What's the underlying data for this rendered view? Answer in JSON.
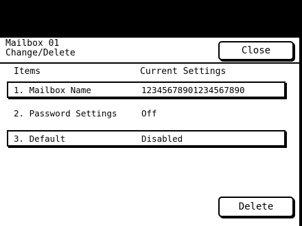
{
  "header": {
    "title_line1": "Mailbox 01",
    "title_line2": "Change/Delete",
    "close_label": "Close"
  },
  "columns": {
    "items": "Items",
    "current_settings": "Current Settings"
  },
  "rows": [
    {
      "item": "1. Mailbox Name",
      "value": "12345678901234567890",
      "selectable": true
    },
    {
      "item": "2. Password Settings",
      "value": "Off",
      "selectable": false
    },
    {
      "item": "3. Default",
      "value": "Disabled",
      "selectable": true
    }
  ],
  "footer": {
    "delete_label": "Delete"
  }
}
